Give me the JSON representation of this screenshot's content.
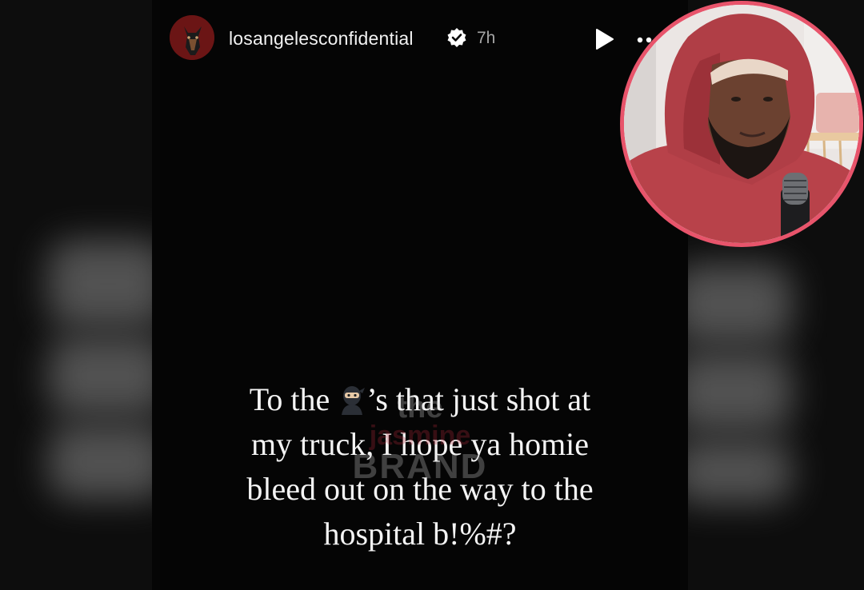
{
  "story": {
    "username": "losangelesconfidential",
    "time_ago": "7h",
    "verified": true,
    "caption": {
      "line1_before": "To the ",
      "line1_after": "’s that just shot at",
      "line2": "my truck, I hope ya homie",
      "line3": "bleed out on the way to the",
      "line4": "hospital b!%#?"
    }
  },
  "watermark": {
    "the": "the",
    "name": "jasmine",
    "brand": "BRAND"
  },
  "icons": {
    "verified": "verified-badge-icon",
    "play": "play-icon",
    "more": "more-dots-icon",
    "ninja": "ninja-emoji-icon"
  },
  "colors": {
    "inset_border": "#e8546b",
    "hoodie": "#b8424a",
    "verified_badge": "#ffffff"
  }
}
